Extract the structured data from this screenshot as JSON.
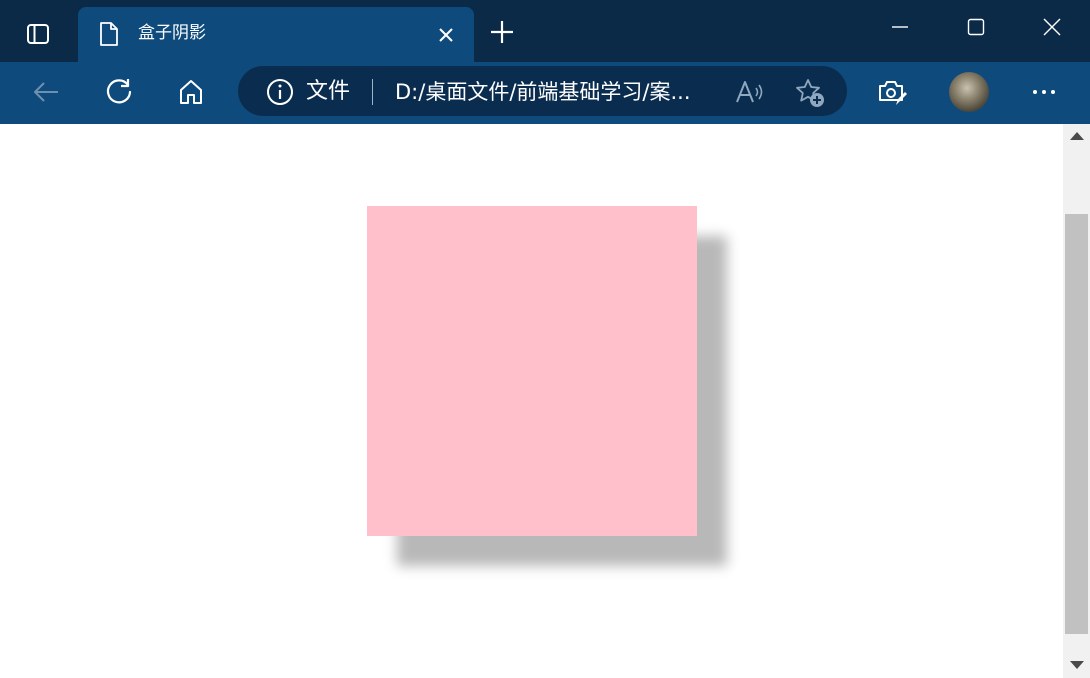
{
  "window": {
    "tab_title": "盒子阴影",
    "icons": {
      "sidebar_toggle": "sidebar-toggle-icon",
      "tab": "document-icon",
      "tab_close": "close-icon",
      "new_tab": "plus-icon",
      "minimize": "minimize-icon",
      "maximize": "maximize-icon",
      "close": "close-icon"
    },
    "colors": {
      "titlebar": "#0a2a47",
      "tab_active": "#0e4a7c"
    }
  },
  "toolbar": {
    "address": {
      "scheme_label": "文件",
      "url": "D:/桌面文件/前端基础学习/案..."
    },
    "icons": {
      "back": "back-arrow-icon",
      "refresh": "refresh-icon",
      "home": "home-icon",
      "info": "info-icon",
      "read_aloud": "read-aloud-icon",
      "favorite_add": "favorite-add-icon",
      "screenshot": "screenshot-edit-icon",
      "more": "more-icon"
    },
    "colors": {
      "toolbar": "#0e4a7c",
      "addressbar": "#0a2d4f"
    }
  },
  "page": {
    "box": {
      "color": "#ffc0cb",
      "shadow_color": "#b9b9b9"
    }
  }
}
